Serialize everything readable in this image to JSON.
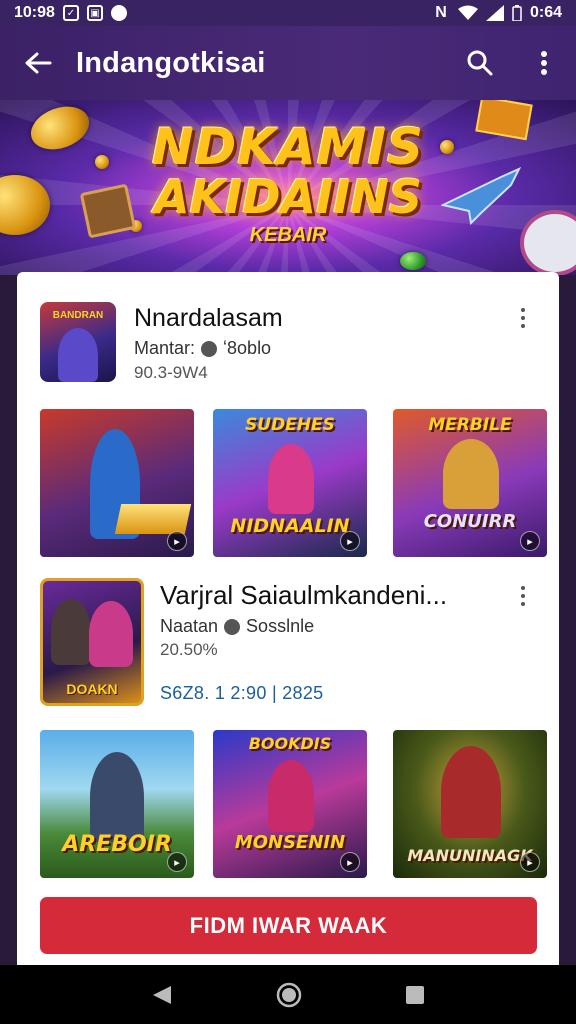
{
  "status": {
    "time": "10:98",
    "battery_text": "0:64"
  },
  "appbar": {
    "title": "Indangotkisai"
  },
  "banner": {
    "line1": "NDKAMIS",
    "line2": "AKIDAIINS",
    "line3": "KEBAIR"
  },
  "app1": {
    "name": "Nnardalasam",
    "meta_label": "Mantar:",
    "meta_value": "ʻ8oblo",
    "sub": "90.3-9W4",
    "icon_text": "BANDRAN",
    "thumbs": [
      {
        "label": "",
        "badge": "▸"
      },
      {
        "label": "NIDNAALIN",
        "top": "SUDEHES",
        "badge": "▸"
      },
      {
        "label": "CONUIRR",
        "top": "MERBILE",
        "badge": "▸"
      }
    ]
  },
  "app2": {
    "name": "Varjral Saiaulmkandeni...",
    "meta_label": "Naatan",
    "meta_value": "Sosslnle",
    "sub": "20.50%",
    "date": "S6Z8. 1 2:90 | 2825",
    "icon_text": "DOAKN",
    "thumbs": [
      {
        "label": "AREBOIR",
        "badge": "▸"
      },
      {
        "label": "MONSENIN",
        "top": "BOOKDIS",
        "badge": "▸"
      },
      {
        "label": "MANUNINAGK",
        "badge": "▸"
      }
    ]
  },
  "cta": {
    "label": "FIDM IWAR WAAK"
  },
  "colors": {
    "accent": "#d42a3a",
    "appbar": "#4a2a78",
    "link": "#1a5ea0"
  }
}
